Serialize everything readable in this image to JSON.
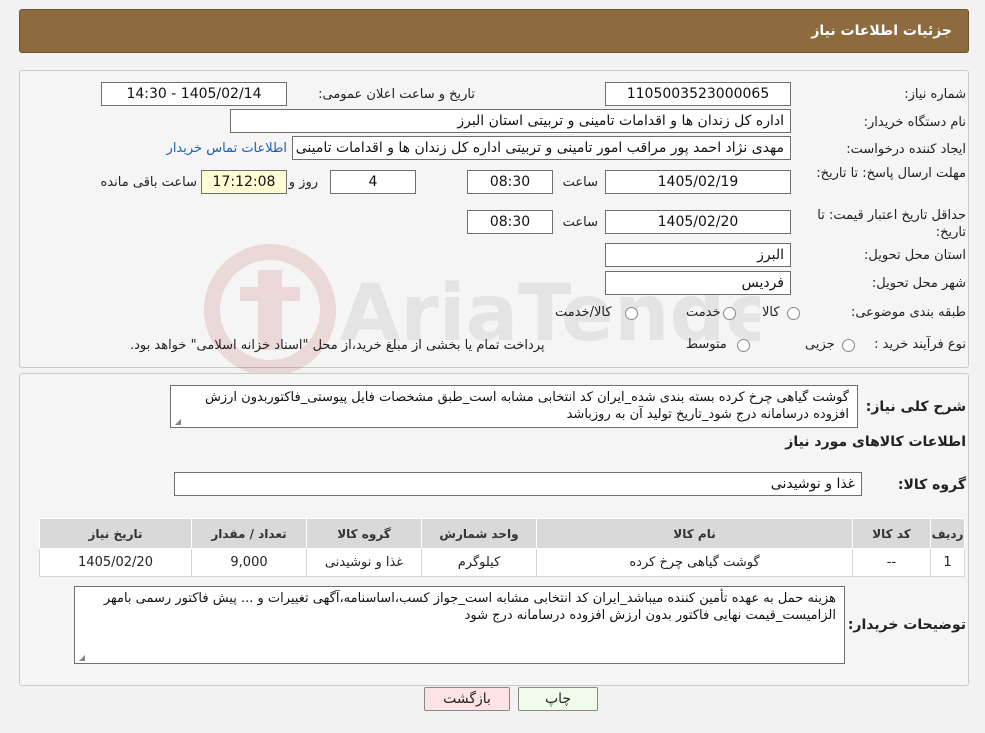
{
  "header": {
    "title": "جزئیات اطلاعات نیاز"
  },
  "fields": {
    "need_number_label": "شماره نیاز:",
    "need_number": "1105003523000065",
    "announce_label": "تاریخ و ساعت اعلان عمومی:",
    "announce_value": "1405/02/14 - 14:30",
    "buyer_org_label": "نام دستگاه خریدار:",
    "buyer_org": "اداره کل زندان ها و اقدامات تامینی و تربیتی استان البرز",
    "requester_label": "ایجاد کننده درخواست:",
    "requester": "مهدی نژاد احمد پور مراقب امور تامینی و تربیتی اداره کل زندان ها و اقدامات تامینی",
    "contact_link": "اطلاعات تماس خریدار",
    "deadline_label": "مهلت ارسال پاسخ: تا تاریخ:",
    "deadline_date": "1405/02/19",
    "time_label": "ساعت",
    "deadline_time": "08:30",
    "days_value": "4",
    "days_label": "روز و",
    "remaining_time": "17:12:08",
    "remaining_label": "ساعت باقی مانده",
    "price_validity_label": "حداقل تاریخ اعتبار قیمت: تا تاریخ:",
    "price_validity_date": "1405/02/20",
    "price_validity_time": "08:30",
    "province_label": "استان محل تحویل:",
    "province": "البرز",
    "city_label": "شهر محل تحویل:",
    "city": "فردیس",
    "category_label": "طبقه بندی موضوعی:",
    "category_options": [
      "کالا",
      "خدمت",
      "کالا/خدمت"
    ],
    "process_label": "نوع فرآیند خرید :",
    "process_options": [
      "جزیی",
      "متوسط"
    ],
    "process_note": "پرداخت تمام یا بخشی از مبلغ خرید،از محل \"اسناد خزانه اسلامی\" خواهد بود."
  },
  "description": {
    "label": "شرح کلی نیاز:",
    "text": "گوشت گیاهی چرخ کرده بسته بندی شده_ایران کد انتخابی مشابه است_طبق مشخصات فایل پیوستی_فاکتوربدون ارزش افزوده درسامانه درج شود_تاریخ تولید آن به روزباشد"
  },
  "goods": {
    "section_title": "اطلاعات کالاهای مورد نیاز",
    "group_label": "گروه کالا:",
    "group_value": "غذا و نوشیدنی",
    "columns": [
      "ردیف",
      "کد کالا",
      "نام کالا",
      "واحد شمارش",
      "گروه کالا",
      "تعداد / مقدار",
      "تاریخ نیاز"
    ],
    "rows": [
      [
        "1",
        "--",
        "گوشت گیاهی چرخ کرده",
        "کیلوگرم",
        "غذا و نوشیدنی",
        "9,000",
        "1405/02/20"
      ]
    ]
  },
  "buyer_notes": {
    "label": "توضیحات خریدار:",
    "text": "هزینه حمل به عهده تأمین کننده میباشد_ایران کد انتخابی مشابه است_جواز کسب،اساسنامه،آگهی تغییرات و ... پیش فاکتور رسمی بامهر الزامیست_قیمت نهایی فاکتور بدون ارزش افزوده درسامانه درج شود"
  },
  "buttons": {
    "print": "چاپ",
    "back": "بازگشت"
  },
  "colors": {
    "header_bg": "#8e6b3f",
    "link": "#1e5fb7",
    "remaining_bg": "#fffbd2"
  }
}
